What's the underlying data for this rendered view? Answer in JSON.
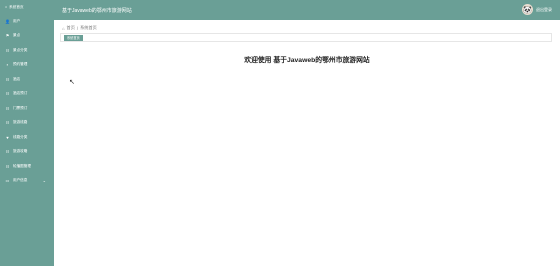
{
  "sidebar": {
    "top": {
      "icon": "home-icon",
      "label": "系统首页"
    },
    "items": [
      {
        "icon": "user-icon",
        "glyph": "👤",
        "label": "用户"
      },
      {
        "icon": "flag-icon",
        "glyph": "⚑",
        "label": "景点"
      },
      {
        "icon": "grid-icon",
        "glyph": "☷",
        "label": "景点分类"
      },
      {
        "icon": "bookmark-icon",
        "glyph": "▪",
        "label": "预约管理"
      },
      {
        "icon": "grid-icon",
        "glyph": "☷",
        "label": "酒店"
      },
      {
        "icon": "grid-icon",
        "glyph": "☷",
        "label": "酒店预订"
      },
      {
        "icon": "grid-icon",
        "glyph": "☷",
        "label": "门票预订"
      },
      {
        "icon": "grid-icon",
        "glyph": "☷",
        "label": "旅游线路"
      },
      {
        "icon": "pin-icon",
        "glyph": "♥",
        "label": "线路分类"
      },
      {
        "icon": "grid-icon",
        "glyph": "☷",
        "label": "旅游攻略"
      },
      {
        "icon": "grid-icon",
        "glyph": "☷",
        "label": "轮播图管理"
      },
      {
        "icon": "monitor-icon",
        "glyph": "▭",
        "label": "用户信息",
        "caret": "⌄"
      }
    ]
  },
  "header": {
    "title": "基于Javaweb的鄂州市旅游网站",
    "user": "退出登录",
    "avatar_glyph": "🐼"
  },
  "main": {
    "breadcrumb": {
      "home": "首页",
      "separator": "/",
      "current": "系统首页"
    },
    "tab": "系统首页",
    "welcome": "欢迎使用 基于Javaweb的鄂州市旅游网站"
  },
  "colors": {
    "accent": "#6a9f96"
  }
}
